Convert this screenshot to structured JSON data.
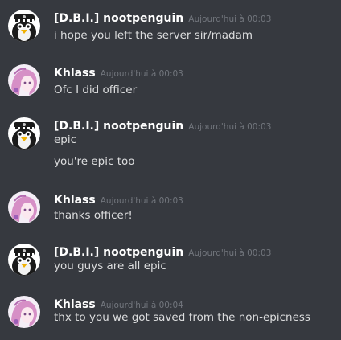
{
  "messages": [
    {
      "author": "[D.B.I.] nootpenguin",
      "avatar_icon": "police-penguin-avatar",
      "timestamp": "Aujourd'hui à 00:03",
      "lines": [
        "i hope you left the server sir/madam"
      ]
    },
    {
      "author": "Khlass",
      "avatar_icon": "anime-girl-avatar",
      "timestamp": "Aujourd'hui à 00:03",
      "lines": [
        "Ofc I did officer"
      ]
    },
    {
      "author": "[D.B.I.] nootpenguin",
      "avatar_icon": "police-penguin-avatar",
      "timestamp": "Aujourd'hui à 00:03",
      "lines": [
        "epic",
        "you're epic too"
      ]
    },
    {
      "author": "Khlass",
      "avatar_icon": "anime-girl-avatar",
      "timestamp": "Aujourd'hui à 00:03",
      "lines": [
        "thanks officer!"
      ]
    },
    {
      "author": "[D.B.I.] nootpenguin",
      "avatar_icon": "police-penguin-avatar",
      "timestamp": "Aujourd'hui à 00:03",
      "lines": [
        "you guys are all epic"
      ]
    },
    {
      "author": "Khlass",
      "avatar_icon": "anime-girl-avatar",
      "timestamp": "Aujourd'hui à 00:04",
      "lines": [
        "thx to you we got saved from the non-epicness"
      ]
    }
  ],
  "colors": {
    "background": "#36393f",
    "username": "#ffffff",
    "timestamp": "#72767d",
    "message_text": "#dcddde"
  }
}
